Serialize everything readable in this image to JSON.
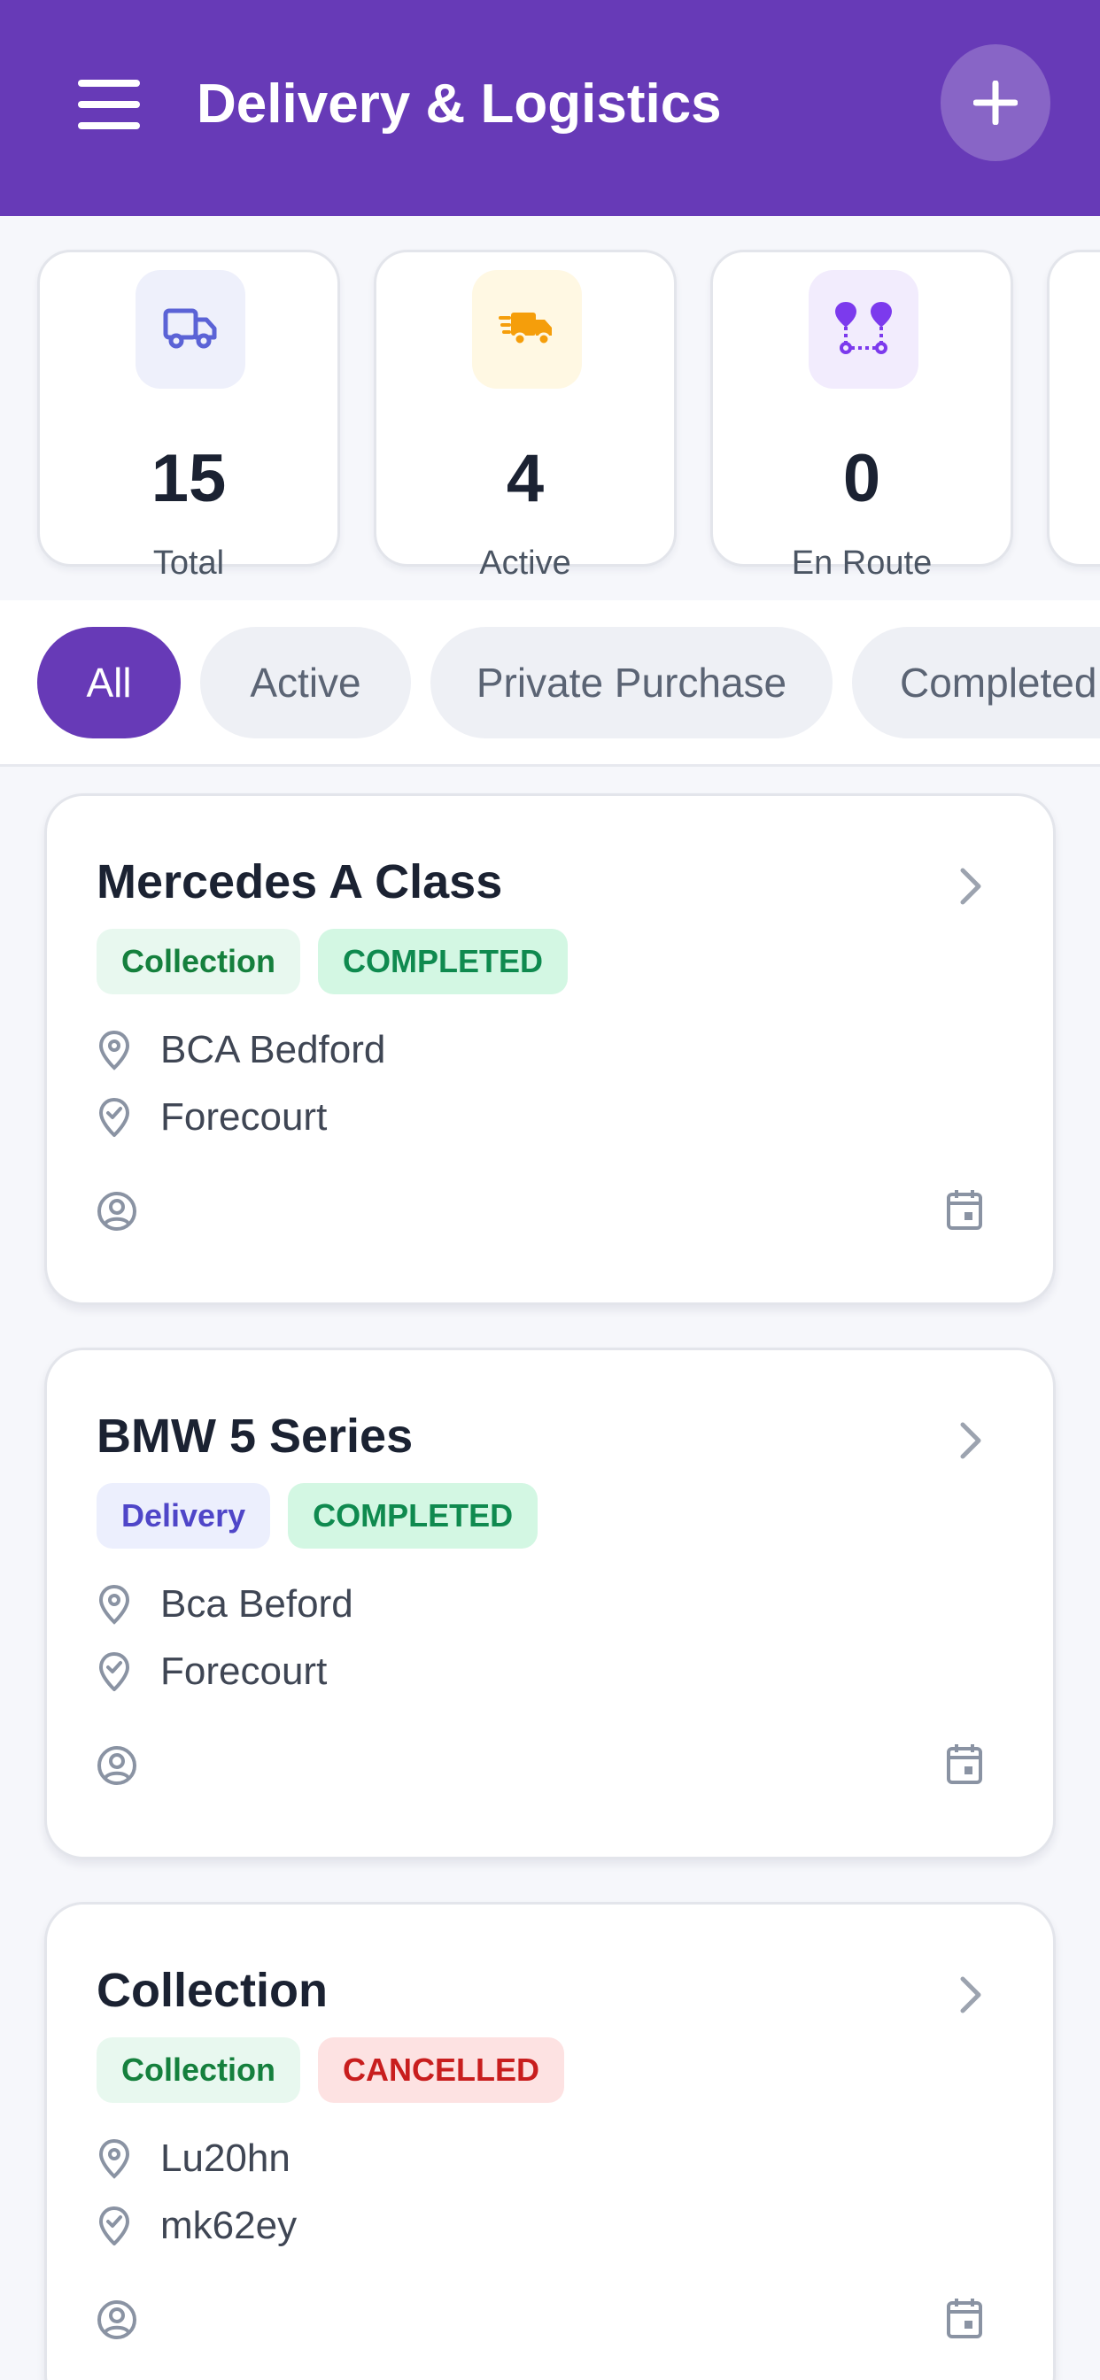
{
  "header": {
    "title": "Delivery & Logistics",
    "menu_icon": "hamburger-menu-icon",
    "add_icon": "plus-icon",
    "color": "#673ab7"
  },
  "stats": [
    {
      "value": "15",
      "label": "Total",
      "icon": "truck-icon",
      "icon_bg": "#eef0fb",
      "icon_color": "#5b63d6"
    },
    {
      "value": "4",
      "label": "Active",
      "icon": "fast-truck-icon",
      "icon_bg": "#fff8e3",
      "icon_color": "#f59e0b"
    },
    {
      "value": "0",
      "label": "En Route",
      "icon": "route-icon",
      "icon_bg": "#f2ecfd",
      "icon_color": "#7c3aed"
    }
  ],
  "filters": [
    {
      "label": "All",
      "selected": true
    },
    {
      "label": "Active",
      "selected": false
    },
    {
      "label": "Private Purchase",
      "selected": false
    },
    {
      "label": "Completed",
      "selected": false
    }
  ],
  "jobs": [
    {
      "title": "Mercedes A Class",
      "type": "Collection",
      "status": "COMPLETED",
      "from": "BCA Bedford",
      "to": "Forecourt"
    },
    {
      "title": "BMW 5 Series",
      "type": "Delivery",
      "status": "COMPLETED",
      "from": "Bca Beford",
      "to": "Forecourt"
    },
    {
      "title": "Collection",
      "type": "Collection",
      "status": "CANCELLED",
      "from": "Lu20hn",
      "to": "mk62ey"
    }
  ]
}
